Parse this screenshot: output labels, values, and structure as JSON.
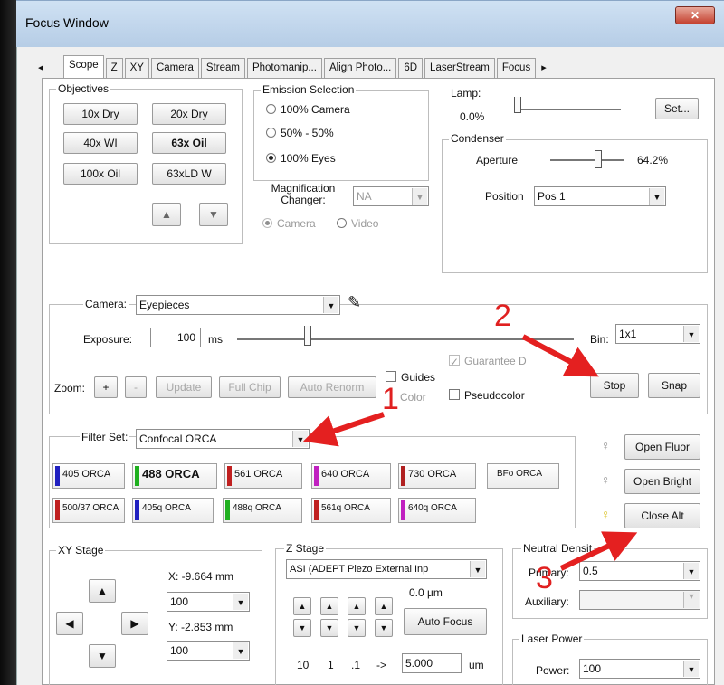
{
  "window": {
    "title": "Focus Window",
    "close_glyph": "✕"
  },
  "tabs": [
    {
      "label": "◂"
    },
    {
      "label": "Scope"
    },
    {
      "label": "Z"
    },
    {
      "label": "XY"
    },
    {
      "label": "Camera"
    },
    {
      "label": "Stream"
    },
    {
      "label": "Photomanip..."
    },
    {
      "label": "Align Photo..."
    },
    {
      "label": "6D"
    },
    {
      "label": "LaserStream"
    },
    {
      "label": "Focus"
    },
    {
      "label": "▸"
    }
  ],
  "objectives": {
    "title": "Objectives",
    "buttons": [
      "10x Dry",
      "20x Dry",
      "40x WI",
      "63x Oil",
      "100x Oil",
      "63xLD W"
    ],
    "selected": "63x Oil",
    "up": "▲",
    "down": "▼"
  },
  "emission": {
    "title": "Emission Selection",
    "options": [
      "100% Camera",
      "50% - 50%",
      "100% Eyes"
    ],
    "selected": "100% Eyes",
    "mag_label": "Magnification Changer:",
    "mag_value": "NA",
    "camera": "Camera",
    "video": "Video"
  },
  "lamp": {
    "label": "Lamp:",
    "value": "0.0%",
    "set_button": "Set...",
    "level": 0.0
  },
  "condenser": {
    "title": "Condenser",
    "aperture_label": "Aperture",
    "aperture_value": "64.2%",
    "aperture_level": 0.642,
    "position_label": "Position",
    "position_value": "Pos 1"
  },
  "camera": {
    "label": "Camera:",
    "value": "Eyepieces",
    "exposure_label": "Exposure:",
    "exposure_value": "100",
    "exposure_unit": "ms",
    "bin_label": "Bin:",
    "bin_value": "1x1",
    "guarantee": "Guarantee D",
    "zoom_label": "Zoom:",
    "zoom_plus": "+",
    "zoom_minus": "-",
    "update": "Update",
    "full_chip": "Full Chip",
    "auto_renorm": "Auto Renorm",
    "guides": "Guides",
    "color": "Color",
    "pseudocolor": "Pseudocolor",
    "stop": "Stop",
    "snap": "Snap"
  },
  "filter": {
    "label": "Filter Set:",
    "value": "Confocal ORCA",
    "row1": [
      {
        "label": "405 ORCA",
        "color": "#2020c0"
      },
      {
        "label": "488 ORCA",
        "color": "#20b020"
      },
      {
        "label": "561 ORCA",
        "color": "#c02020"
      },
      {
        "label": "640 ORCA",
        "color": "#c020c0"
      },
      {
        "label": "730 ORCA",
        "color": "#b02020"
      },
      {
        "label": "BFo ORCA",
        "color": ""
      }
    ],
    "row2": [
      {
        "label": "500/37 ORCA",
        "color": "#c02020"
      },
      {
        "label": "405q ORCA",
        "color": "#2020c0"
      },
      {
        "label": "488q ORCA",
        "color": "#20b020"
      },
      {
        "label": "561q ORCA",
        "color": "#c02020"
      },
      {
        "label": "640q ORCA",
        "color": "#c020c0"
      }
    ],
    "selected": "488 ORCA"
  },
  "shutters": {
    "open_fluor": "Open Fluor",
    "open_bright": "Open Bright",
    "close_alt": "Close Alt"
  },
  "xy_stage": {
    "title": "XY Stage",
    "x_label": "X: -9.664 mm",
    "y_label": "Y: -2.853 mm",
    "step_x": "100",
    "step_y": "100"
  },
  "z_stage": {
    "title": "Z Stage",
    "device": "ASI (ADEPT Piezo External Inp",
    "position": "0.0 µm",
    "auto_focus": "Auto Focus",
    "steps": [
      "10",
      "1",
      ".1",
      "->"
    ],
    "step_value": "5.000",
    "unit": "um"
  },
  "neutral": {
    "title": "Neutral Densit",
    "primary_label": "Primary:",
    "primary_value": "0.5",
    "auxiliary_label": "Auxiliary:"
  },
  "laser": {
    "title": "Laser Power",
    "power_label": "Power:",
    "power_value": "100"
  },
  "annotations": {
    "one": "1",
    "two": "2",
    "three": "3"
  }
}
